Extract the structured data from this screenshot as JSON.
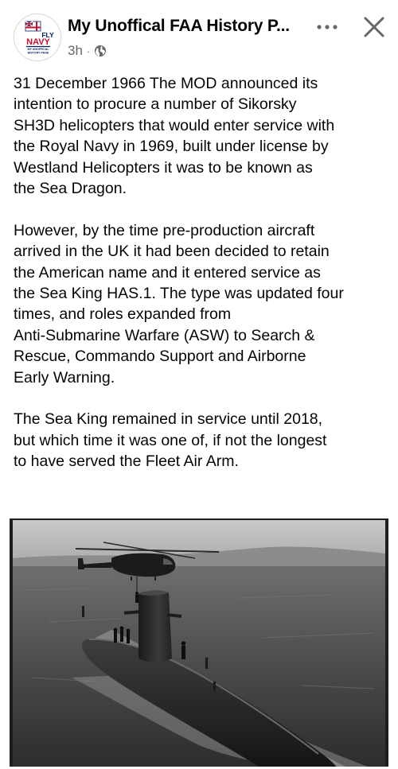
{
  "header": {
    "page_name": "My Unoffical FAA History P...",
    "time_ago": "3h",
    "separator": "·",
    "privacy_icon": "globe-icon",
    "more_icon": "more-dots-icon",
    "close_icon": "close-icon"
  },
  "avatar": {
    "logo_line1": "FLY",
    "logo_line2": "NAVY",
    "logo_line3": "MY UNOFFICAL",
    "logo_line4": "HISTORY PAGE"
  },
  "post": {
    "paragraphs": [
      "31 December 1966 The MOD announced its\nintention to procure a number of Sikorsky\nSH3D helicopters that would enter service with\nthe Royal Navy in 1969, built under license by\nWestland Helicopters it was to be known as\nthe Sea Dragon.",
      "However, by the time pre-production aircraft\narrived in the UK it had been decided to retain\nthe American name and it entered service as\nthe Sea King HAS.1. The type was updated four\ntimes, and roles expanded from\nAnti-Submarine Warfare (ASW) to Search &\nRescue, Commando Support and Airborne\nEarly Warning.",
      "The Sea King remained in service until 2018,\nbut which time it was one of, if not the longest\nto have served the Fleet Air Arm."
    ]
  },
  "colors": {
    "text": "#050505",
    "secondary_text": "#65676b",
    "flag_red": "#c8102e",
    "flag_blue": "#012169"
  }
}
